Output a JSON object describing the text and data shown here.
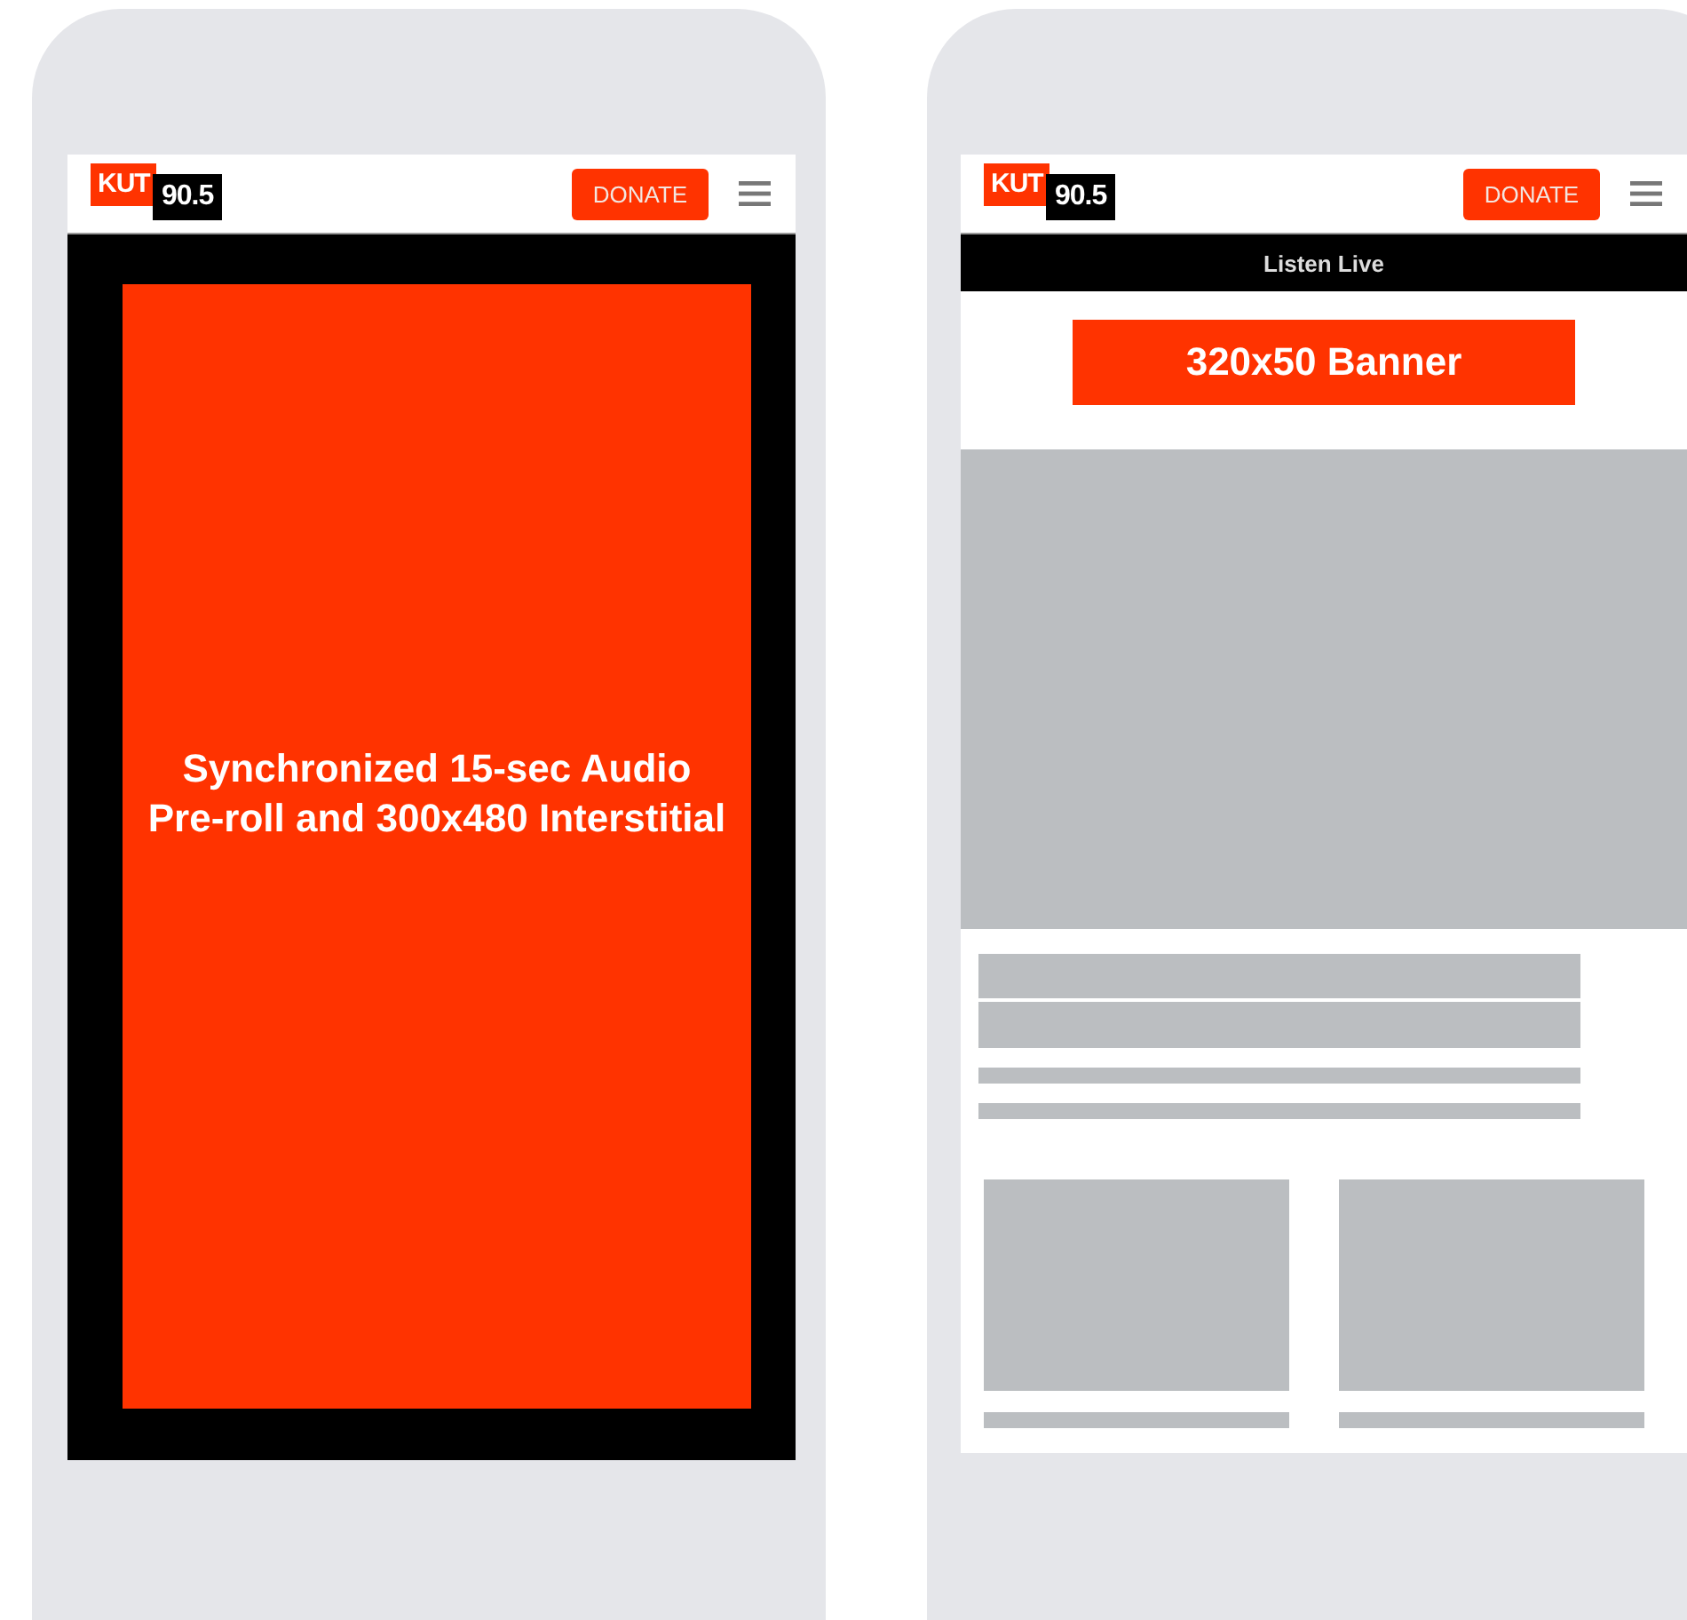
{
  "phones": [
    {
      "kind": "interstitial",
      "header": {
        "logo_call": "KUT",
        "logo_frequency": "90.5",
        "donate": "DONATE"
      },
      "ad": "Synchronized 15-sec Audio Pre-roll and 300x480 Interstitial"
    },
    {
      "kind": "article",
      "header": {
        "logo_call": "KUT",
        "logo_frequency": "90.5",
        "donate": "DONATE"
      },
      "listen_live": "Listen Live",
      "banner": "320x50 Banner"
    }
  ]
}
